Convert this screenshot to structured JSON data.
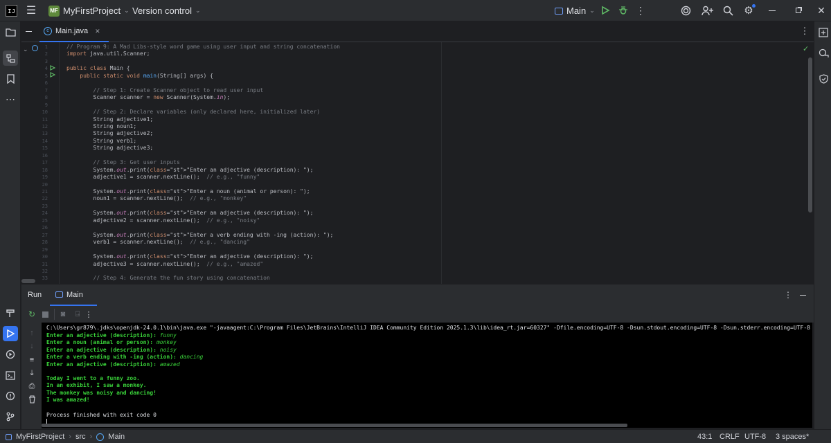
{
  "titlebar": {
    "logo_text": "IJ",
    "project_badge": "MF",
    "project_name": "MyFirstProject",
    "vcs_label": "Version control",
    "run_config": "Main"
  },
  "editor": {
    "tab_label": "Main.java",
    "lines": [
      {
        "n": "1",
        "t": "// Program 9: A Mad Libs-style word game using user input and string concatenation",
        "c": "cm"
      },
      {
        "n": "2",
        "t": "import java.util.Scanner;",
        "c": "import"
      },
      {
        "n": "3",
        "t": "",
        "c": ""
      },
      {
        "n": "4",
        "t": "public class Main {",
        "c": "class"
      },
      {
        "n": "5",
        "t": "    public static void main(String[] args) {",
        "c": "main"
      },
      {
        "n": "6",
        "t": "",
        "c": ""
      },
      {
        "n": "7",
        "t": "        // Step 1: Create Scanner object to read user input",
        "c": "cm"
      },
      {
        "n": "8",
        "t": "        Scanner scanner = new Scanner(System.in);",
        "c": "scanner"
      },
      {
        "n": "9",
        "t": "",
        "c": ""
      },
      {
        "n": "10",
        "t": "        // Step 2: Declare variables (only declared here, initialized later)",
        "c": "cm"
      },
      {
        "n": "11",
        "t": "        String adjective1;",
        "c": ""
      },
      {
        "n": "12",
        "t": "        String noun1;",
        "c": ""
      },
      {
        "n": "13",
        "t": "        String adjective2;",
        "c": ""
      },
      {
        "n": "14",
        "t": "        String verb1;",
        "c": ""
      },
      {
        "n": "15",
        "t": "        String adjective3;",
        "c": ""
      },
      {
        "n": "16",
        "t": "",
        "c": ""
      },
      {
        "n": "17",
        "t": "        // Step 3: Get user inputs",
        "c": "cm"
      },
      {
        "n": "18",
        "t": "        System.out.print(\"Enter an adjective (description): \");",
        "c": "print"
      },
      {
        "n": "19",
        "t": "        adjective1 = scanner.nextLine();  // e.g., \"funny\"",
        "c": "read"
      },
      {
        "n": "20",
        "t": "",
        "c": ""
      },
      {
        "n": "21",
        "t": "        System.out.print(\"Enter a noun (animal or person): \");",
        "c": "print"
      },
      {
        "n": "22",
        "t": "        noun1 = scanner.nextLine();  // e.g., \"monkey\"",
        "c": "read"
      },
      {
        "n": "23",
        "t": "",
        "c": ""
      },
      {
        "n": "24",
        "t": "        System.out.print(\"Enter an adjective (description): \");",
        "c": "print"
      },
      {
        "n": "25",
        "t": "        adjective2 = scanner.nextLine();  // e.g., \"noisy\"",
        "c": "read"
      },
      {
        "n": "26",
        "t": "",
        "c": ""
      },
      {
        "n": "27",
        "t": "        System.out.print(\"Enter a verb ending with -ing (action): \");",
        "c": "print"
      },
      {
        "n": "28",
        "t": "        verb1 = scanner.nextLine();  // e.g., \"dancing\"",
        "c": "read"
      },
      {
        "n": "29",
        "t": "",
        "c": ""
      },
      {
        "n": "30",
        "t": "        System.out.print(\"Enter an adjective (description): \");",
        "c": "print"
      },
      {
        "n": "31",
        "t": "        adjective3 = scanner.nextLine();  // e.g., \"amazed\"",
        "c": "read"
      },
      {
        "n": "32",
        "t": "",
        "c": ""
      },
      {
        "n": "33",
        "t": "        // Step 4: Generate the fun story using concatenation",
        "c": "cm"
      }
    ]
  },
  "run": {
    "tab_run": "Run",
    "tab_main": "Main",
    "command": "C:\\Users\\gr879\\.jdks\\openjdk-24.0.1\\bin\\java.exe \"-javaagent:C:\\Program Files\\JetBrains\\IntelliJ IDEA Community Edition 2025.1.3\\lib\\idea_rt.jar=60327\" -Dfile.encoding=UTF-8 -Dsun.stdout.encoding=UTF-8 -Dsun.stderr.encoding=UTF-8 -classpath C:\\U",
    "prompts": [
      {
        "p": "Enter an adjective (description): ",
        "v": "funny"
      },
      {
        "p": "Enter a noun (animal or person): ",
        "v": "monkey"
      },
      {
        "p": "Enter an adjective (description): ",
        "v": "noisy"
      },
      {
        "p": "Enter a verb ending with -ing (action): ",
        "v": "dancing"
      },
      {
        "p": "Enter an adjective (description): ",
        "v": "amazed"
      }
    ],
    "story": [
      "Today I went to a funny zoo.",
      "In an exhibit, I saw a monkey.",
      "The monkey was noisy and dancing!",
      "I was amazed!"
    ],
    "exit_text": "Process finished with exit code 0"
  },
  "status": {
    "breadcrumb_project": "MyFirstProject",
    "breadcrumb_src": "src",
    "breadcrumb_main": "Main",
    "position": "43:1",
    "line_sep": "CRLF",
    "encoding": "UTF-8",
    "indent": "3 spaces*"
  },
  "colors": {
    "accent": "#3574f0",
    "console_green": "#3ad43a",
    "keyword": "#cf8e6d",
    "comment": "#7a7e85",
    "string": "#6aab73"
  }
}
